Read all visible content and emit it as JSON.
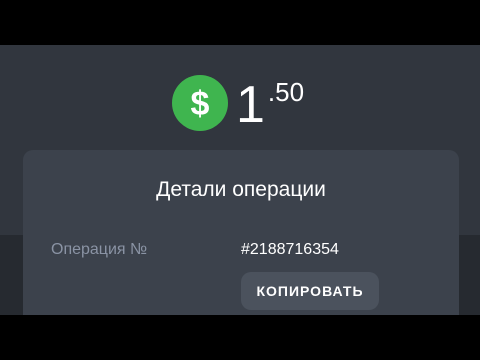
{
  "payment": {
    "currency_icon": "dollar-icon",
    "amount_integer": "1",
    "amount_fraction": ".50"
  },
  "details": {
    "title": "Детали операции",
    "operation_label": "Операция №",
    "operation_value": "#2188716354",
    "copy_label": "КОПИРОВАТЬ"
  },
  "colors": {
    "background": "#31363e",
    "card": "#3c424c",
    "accent_green": "#3fb54f",
    "label_gray": "#8a93a4",
    "button": "#4b525d"
  }
}
